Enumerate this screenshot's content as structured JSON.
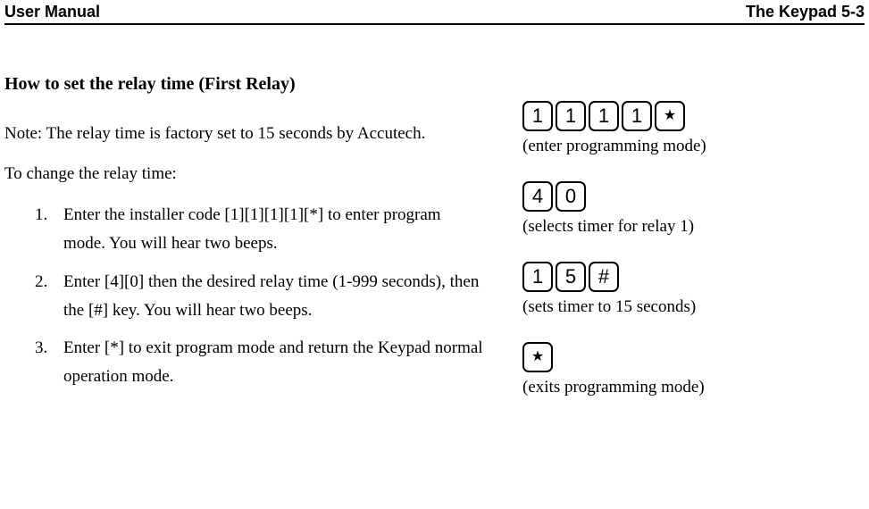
{
  "header": {
    "left": "User Manual",
    "right": "The Keypad 5-3"
  },
  "section_title": "How to set the relay time (First Relay)",
  "note": "Note: The relay time is factory set to 15 seconds by Accutech.",
  "intro": "To change the relay time:",
  "steps": [
    "Enter the installer code [1][1][1][1][*] to enter program mode. You will hear two beeps.",
    "Enter [4][0] then the desired relay time (1-999 seconds), then the [#] key. You will hear two beeps.",
    "Enter [*] to exit program mode and return the Keypad normal operation mode."
  ],
  "key_groups": [
    {
      "keys": [
        "1",
        "1",
        "1",
        "1",
        "*"
      ],
      "caption": "(enter programming mode)"
    },
    {
      "keys": [
        "4",
        "0"
      ],
      "caption": "(selects timer for relay 1)"
    },
    {
      "keys": [
        "1",
        "5",
        "#"
      ],
      "caption": "(sets timer to 15 seconds)"
    },
    {
      "keys": [
        "*"
      ],
      "caption": "(exits programming mode)"
    }
  ]
}
